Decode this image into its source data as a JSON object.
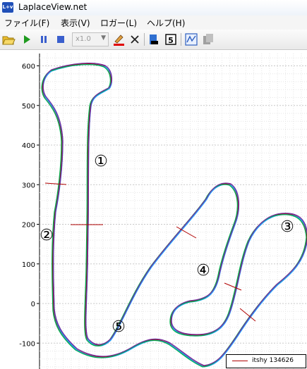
{
  "window": {
    "title": "LaplaceView.net",
    "icon": "L+v"
  },
  "menu": [
    {
      "label": "ファイル(F)"
    },
    {
      "label": "表示(V)"
    },
    {
      "label": "ロガー(L)"
    },
    {
      "label": "ヘルプ(H)"
    }
  ],
  "toolbar": {
    "buttons": [
      "open-folder-icon",
      "play-icon",
      "pause-icon",
      "stop-icon",
      "speed-dropdown",
      "marker-pen-icon",
      "close-x-icon",
      "export-icon",
      "lap-5-icon",
      "graph-view-icon",
      "copy-icon"
    ],
    "speed_value": "x1.0",
    "lap_label": "5"
  },
  "chart_data": {
    "type": "line",
    "title": "",
    "xlabel": "",
    "ylabel": "",
    "yticks": [
      "600",
      "500",
      "400",
      "300",
      "200",
      "100",
      "0",
      "-100"
    ],
    "ylim": [
      -160,
      640
    ],
    "grid": true,
    "legend": {
      "label": "itshy 134626",
      "placement": "bottom-right",
      "color": "#b00000"
    },
    "markers": [
      "①",
      "②",
      "③",
      "④",
      "⑤"
    ],
    "series_colors": [
      "#b00000",
      "#1a9cff",
      "#00b050",
      "#7030a0"
    ]
  }
}
